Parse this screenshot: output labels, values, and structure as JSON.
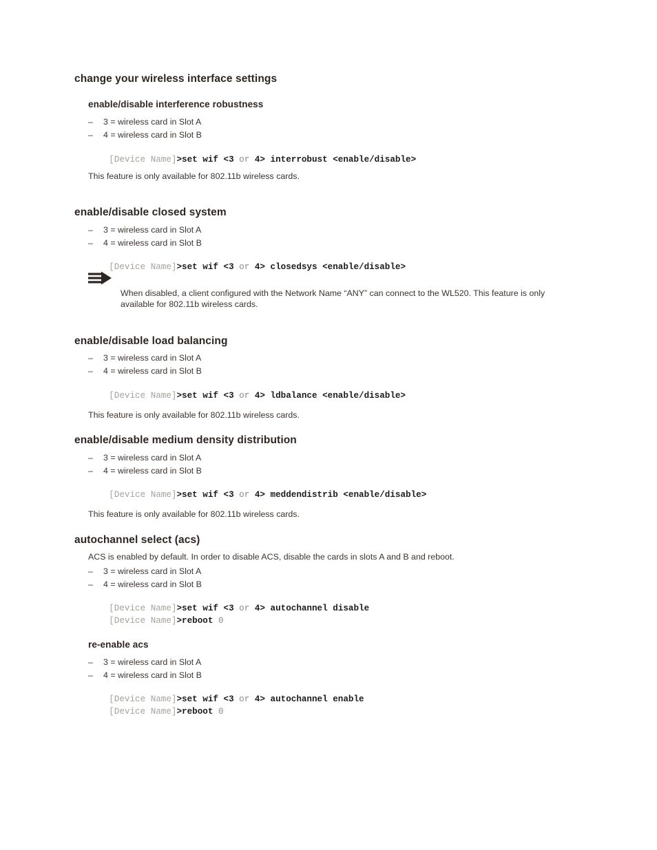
{
  "page": {
    "title": "change your wireless interface settings",
    "background": "#ffffff",
    "heading_color": "#2e2622",
    "body_color": "#3a332e",
    "prompt_color": "#a7a19c",
    "command_color": "#1c1c1c"
  },
  "common": {
    "slot_a": "3 = wireless card in Slot A",
    "slot_b": "4 = wireless card in Slot B",
    "dash": "–",
    "prompt": "[Device Name]",
    "gt": ">",
    "availability_note": "This feature is only available for 802.11b wireless cards."
  },
  "sections": {
    "interference_robustness": {
      "heading": "enable/disable interference robustness",
      "bullet_a": "3 = wireless card in Slot A",
      "bullet_b": "4 = wireless card in Slot B",
      "command": {
        "prompt": "[Device Name]",
        "gt": ">",
        "part1": "set wif <3",
        "or": " or ",
        "part2": "4> interrobust <enable/disable>"
      },
      "note": "This feature is only available for 802.11b wireless cards."
    },
    "closed_system": {
      "heading": "enable/disable closed system",
      "bullet_a": "3 = wireless card in Slot A",
      "bullet_b": "4 = wireless card in Slot B",
      "command": {
        "prompt": "[Device Name]",
        "gt": ">",
        "part1": "set wif <3",
        "or": " or ",
        "part2": "4> closedsys <enable/disable>"
      },
      "note_icon": "note-arrow-icon",
      "note": "When disabled, a client configured with the Network Name “ANY” can connect to the WL520. This feature is only available for 802.11b wireless cards."
    },
    "load_balancing": {
      "heading": "enable/disable load balancing",
      "bullet_a": "3 = wireless card in Slot A",
      "bullet_b": "4 = wireless card in Slot B",
      "command": {
        "prompt": "[Device Name]",
        "gt": ">",
        "part1": "set wif <3",
        "or": " or ",
        "part2": "4> ldbalance <enable/disable>"
      },
      "note": "This feature is only available for 802.11b wireless cards."
    },
    "medium_density": {
      "heading": "enable/disable medium density distribution",
      "bullet_a": "3 = wireless card in Slot A",
      "bullet_b": "4 = wireless card in Slot B",
      "command": {
        "prompt": "[Device Name]",
        "gt": ">",
        "part1": "set wif <3",
        "or": " or ",
        "part2": "4> meddendistrib <enable/disable>"
      },
      "note": "This feature is only available for 802.11b wireless cards."
    },
    "autochannel": {
      "heading": "autochannel select (acs)",
      "description": "ACS is enabled by default. In order to disable ACS, disable the cards in slots A and B and reboot.",
      "bullet_a": "3 = wireless card in Slot A",
      "bullet_b": "4 = wireless card in Slot B",
      "command1": {
        "prompt": "[Device Name]",
        "gt": ">",
        "part1": "set wif <3",
        "or": " or ",
        "part2": "4> autochannel disable"
      },
      "command2": {
        "prompt": "[Device Name]",
        "gt": ">",
        "cmd": "reboot",
        "arg": " 0"
      }
    },
    "reenable_acs": {
      "heading": "re-enable acs",
      "bullet_a": "3 = wireless card in Slot A",
      "bullet_b": "4 = wireless card in Slot B",
      "command1": {
        "prompt": "[Device Name]",
        "gt": ">",
        "part1": "set wif <3",
        "or": " or ",
        "part2": "4> autochannel enable"
      },
      "command2": {
        "prompt": "[Device Name]",
        "gt": ">",
        "cmd": "reboot",
        "arg": " 0"
      }
    }
  }
}
